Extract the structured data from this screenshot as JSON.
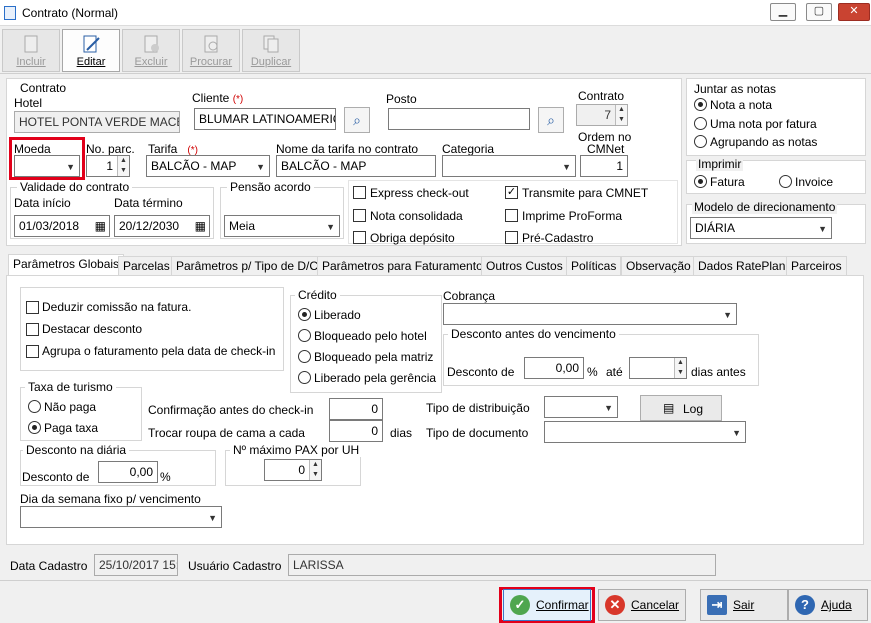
{
  "window": {
    "title": "Contrato (Normal)",
    "min": "▁",
    "max": "▢",
    "close": "✕"
  },
  "toolbar": {
    "incluir": "Incluir",
    "editar": "Editar",
    "excluir": "Excluir",
    "procurar": "Procurar",
    "duplicar": "Duplicar"
  },
  "contrato_grp": {
    "title": "Contrato",
    "hotel_label": "Hotel",
    "hotel_value": "HOTEL PONTA VERDE MACEIÓ",
    "cliente_label": "Cliente",
    "cliente_req": "(*)",
    "cliente_value": "BLUMAR  LATINOAMERICA",
    "posto_label": "Posto",
    "posto_value": "",
    "contrato_label": "Contrato",
    "contrato_value": "7"
  },
  "row2": {
    "moeda_label": "Moeda",
    "moeda_value": "",
    "nparc_label": "No. parc.",
    "nparc_value": "1",
    "tarifa_label": "Tarifa",
    "tarifa_req": "(*)",
    "tarifa_value": "BALCÃO - MAP",
    "nome_tarifa_label": "Nome da tarifa no contrato",
    "nome_tarifa_value": "BALCÃO - MAP",
    "categoria_label": "Categoria",
    "categoria_value": "",
    "ordem_label1": "Ordem no",
    "ordem_label2": "CMNet",
    "ordem_value": "1"
  },
  "validade": {
    "title": "Validade do contrato",
    "inicio_label": "Data início",
    "inicio_value": "01/03/2018",
    "termino_label": "Data término",
    "termino_value": "20/12/2030"
  },
  "pensao": {
    "title": "Pensão acordo",
    "value": "Meia"
  },
  "checks": {
    "express": "Express check-out",
    "consolidada": "Nota consolidada",
    "deposito": "Obriga depósito",
    "transmite": "Transmite para CMNET",
    "proforma": "Imprime ProForma",
    "precadastro": "Pré-Cadastro",
    "checkmark": "✓"
  },
  "juntar": {
    "title": "Juntar as notas",
    "opt1": "Nota a nota",
    "opt2": "Uma nota por fatura",
    "opt3": "Agrupando as notas"
  },
  "imprimir": {
    "title": "Imprimir",
    "opt1": "Fatura",
    "opt2": "Invoice"
  },
  "modelo": {
    "title": "Modelo de direcionamento",
    "value": "DIÁRIA"
  },
  "tabs": [
    "Parâmetros Globais",
    "Parcelas",
    "Parâmetros p/ Tipo de D/C",
    "Parâmetros para Faturamento",
    "Outros Custos",
    "Políticas",
    "Observação",
    "Dados RatePlan",
    "Parceiros"
  ],
  "globais": {
    "deduzir": "Deduzir comissão na fatura.",
    "destacar": "Destacar desconto",
    "agrupa": "Agrupa o faturamento pela data de check-in"
  },
  "credito": {
    "title": "Crédito",
    "opt1": "Liberado",
    "opt2": "Bloqueado pelo hotel",
    "opt3": "Bloqueado pela matriz",
    "opt4": "Liberado pela gerência"
  },
  "cobranca": {
    "label": "Cobrança",
    "value": ""
  },
  "desc_venc": {
    "title": "Desconto antes do vencimento",
    "desconto_label": "Desconto de",
    "desconto_value": "0,00",
    "pct": "%",
    "ate": "até",
    "dias_value": "",
    "dias_antes": "dias antes"
  },
  "turismo": {
    "title": "Taxa de turismo",
    "opt1": "Não paga",
    "opt2": "Paga taxa"
  },
  "confirmacao": {
    "label": "Confirmação antes do check-in",
    "value": "0"
  },
  "troca": {
    "label": "Trocar roupa de cama a cada",
    "value": "0",
    "dias": "dias"
  },
  "distribuicao": {
    "label": "Tipo de distribuição",
    "value": "",
    "log": "Log"
  },
  "documento": {
    "label": "Tipo de documento",
    "value": ""
  },
  "desc_diaria": {
    "title": "Desconto na diária",
    "label": "Desconto de",
    "value": "0,00",
    "pct": "%"
  },
  "pax": {
    "title": "Nº máximo PAX por UH",
    "value": "0"
  },
  "dia_semana": {
    "label": "Dia da semana fixo p/ vencimento",
    "value": ""
  },
  "footer": {
    "data_label": "Data Cadastro",
    "data_value": "25/10/2017 15:0",
    "usuario_label": "Usuário Cadastro",
    "usuario_value": "LARISSA"
  },
  "buttons": {
    "confirmar": "Confirmar",
    "cancelar": "Cancelar",
    "sair": "Sair",
    "ajuda": "Ajuda"
  }
}
